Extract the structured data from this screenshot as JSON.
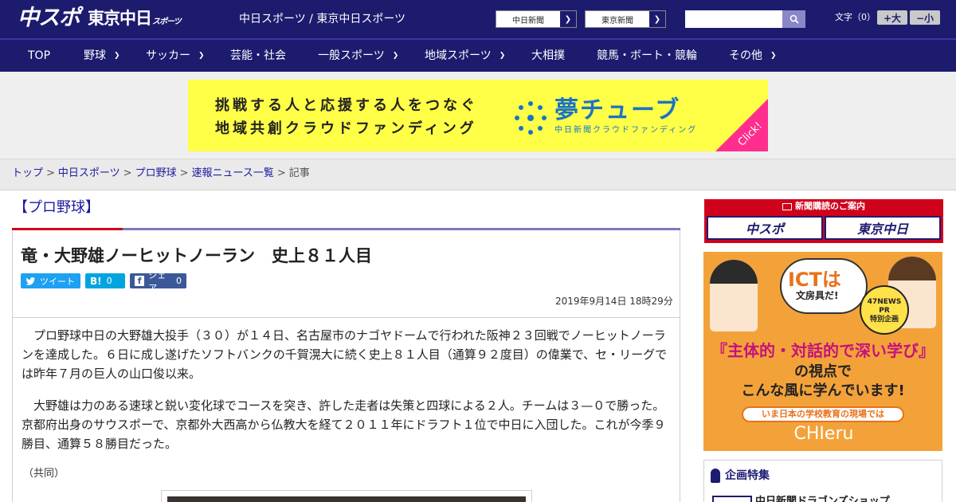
{
  "header": {
    "logo_main": "中スポ",
    "logo_tokyo": "東京中日",
    "logo_tokyo_sub": "スポーツ",
    "site_title": "中日スポーツ / 東京中日スポーツ",
    "paper_links": [
      "中日新聞",
      "東京新聞"
    ],
    "search": {
      "placeholder": "",
      "icon": "search-icon"
    },
    "font_size_label": "文字（0）",
    "font_size_up": "+大",
    "font_size_down": "−小"
  },
  "nav": {
    "items": [
      {
        "label": "TOP",
        "dropdown": false
      },
      {
        "label": "野球",
        "dropdown": true
      },
      {
        "label": "サッカー",
        "dropdown": true
      },
      {
        "label": "芸能・社会",
        "dropdown": false
      },
      {
        "label": "一般スポーツ",
        "dropdown": true
      },
      {
        "label": "地域スポーツ",
        "dropdown": true
      },
      {
        "label": "大相撲",
        "dropdown": false
      },
      {
        "label": "競馬・ボート・競輪",
        "dropdown": false
      },
      {
        "label": "その他",
        "dropdown": true
      }
    ]
  },
  "banner_ad": {
    "line1": "挑戦する人と応援する人をつなぐ",
    "line2": "地域共創クラウドファンディング",
    "brand": "夢チューブ",
    "brand_sub": "中日新聞クラウドファンディング",
    "click": "Click!",
    "colors": {
      "background": "#ffff47",
      "brand": "#1b73c5",
      "corner": "#ff2d8d"
    }
  },
  "breadcrumb": {
    "items": [
      "トップ",
      "中日スポーツ",
      "プロ野球",
      "速報ニュース一覧"
    ],
    "current": "記事"
  },
  "article": {
    "category": "【プロ野球】",
    "headline": "竜・大野雄ノーヒットノーラン　史上８１人目",
    "share": {
      "twitter": "ツイート",
      "hatena": "B!",
      "hatena_count": "0",
      "facebook": "シェア",
      "facebook_count": "0"
    },
    "date": "2019年9月14日 18時29分",
    "paragraphs": [
      "　プロ野球中日の大野雄大投手（３０）が１４日、名古屋市のナゴヤドームで行われた阪神２３回戦でノーヒットノーランを達成した。６日に成し遂げたソフトバンクの千賀滉大に続く史上８１人目（通算９２度目）の偉業で、セ・リーグでは昨年７月の巨人の山口俊以来。",
      "　大野雄は力のある速球と鋭い変化球でコースを突き、許した走者は失策と四球による２人。チームは３—０で勝った。京都府出身のサウスポーで、京都外大西高から仏教大を経て２０１１年にドラフト１位で中日に入団した。これが今季９勝目、通算５８勝目だった。"
    ],
    "credit": "（共同）"
  },
  "sidebar": {
    "subscription": {
      "title": "新聞購読のご案内",
      "buttons": [
        "中スポ",
        "東京中日"
      ]
    },
    "ad": {
      "bubble_main": "ICTは",
      "bubble_sub": "文房具だ!",
      "badge": [
        "47NEWS",
        "PR",
        "特別企画"
      ],
      "main_copy": "『主体的・対話的で深い学び』",
      "sub_copy1": "の視点で",
      "sub_copy2": "こんな風に学んでいます!",
      "ribbon": "いま日本の学校教育の現場では",
      "logo": "CHIeru"
    },
    "feature": {
      "title": "企画特集",
      "item": "中日新聞ドラゴンズショップ"
    }
  },
  "colors": {
    "header_bg": "#1d1b6e",
    "link": "#1d1b9e",
    "accent_red": "#d0021b",
    "twitter": "#1da1f2",
    "hatena": "#00a4de",
    "facebook": "#3b5998"
  }
}
